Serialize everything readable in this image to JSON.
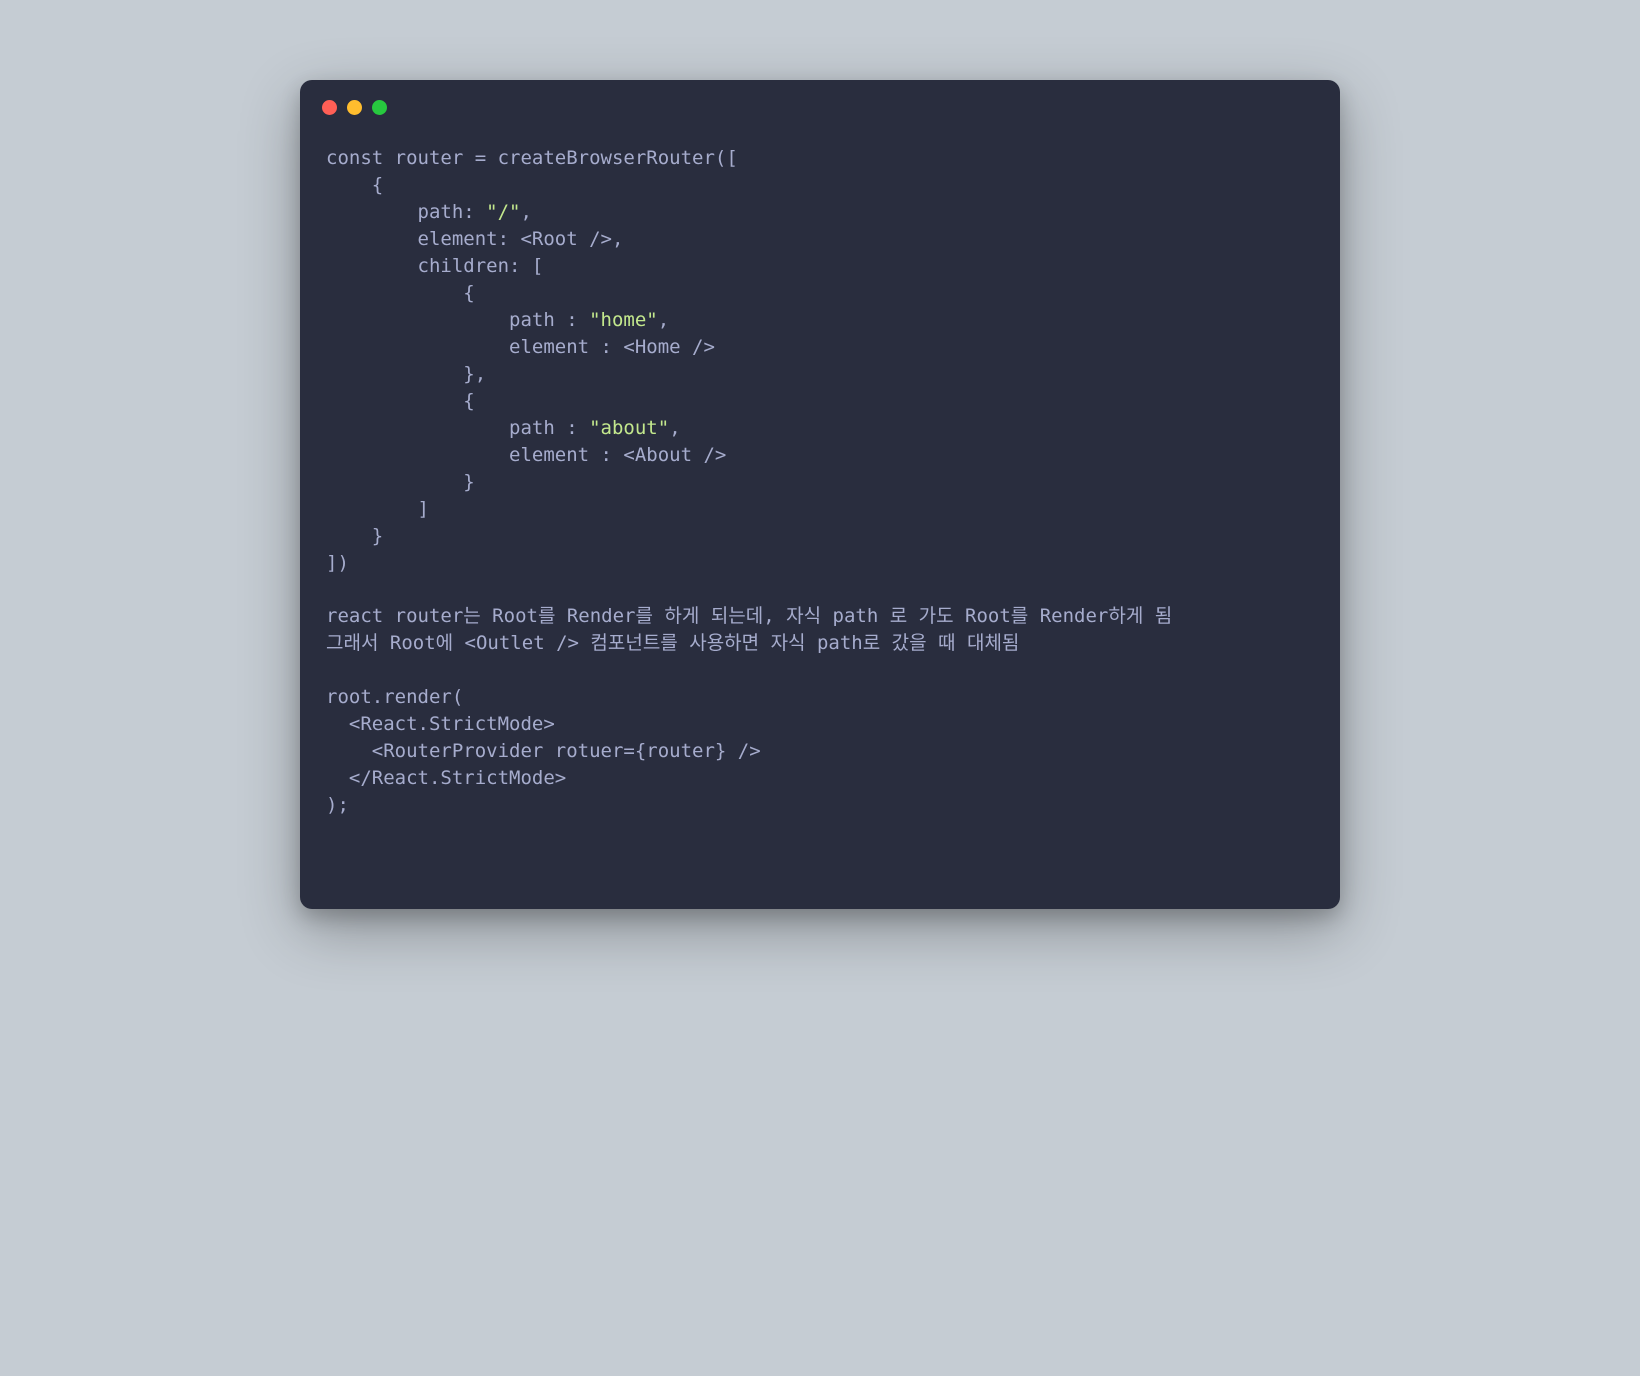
{
  "window": {
    "traffic_lights": [
      "red",
      "yellow",
      "green"
    ]
  },
  "code": {
    "line1": "const router = createBrowserRouter([",
    "line2": "    {",
    "line3_a": "        path: ",
    "line3_b": "\"/\"",
    "line3_c": ",",
    "line4": "        element: <Root />,",
    "line5": "        children: [",
    "line6": "            {",
    "line7_a": "                path : ",
    "line7_b": "\"home\"",
    "line7_c": ",",
    "line8": "                element : <Home />",
    "line9": "            },",
    "line10": "            {",
    "line11_a": "                path : ",
    "line11_b": "\"about\"",
    "line11_c": ",",
    "line12": "                element : <About />",
    "line13": "            }",
    "line14": "        ]",
    "line15": "    }",
    "line16": "])",
    "line17": "",
    "line18": "react router는 Root를 Render를 하게 되는데, 자식 path 로 가도 Root를 Render하게 됨",
    "line19": "그래서 Root에 <Outlet /> 컴포넌트를 사용하면 자식 path로 갔을 때 대체됨",
    "line20": "",
    "line21": "root.render(",
    "line22": "  <React.StrictMode>",
    "line23": "    <RouterProvider rotuer={router} />",
    "line24": "  </React.StrictMode>",
    "line25": ");"
  }
}
